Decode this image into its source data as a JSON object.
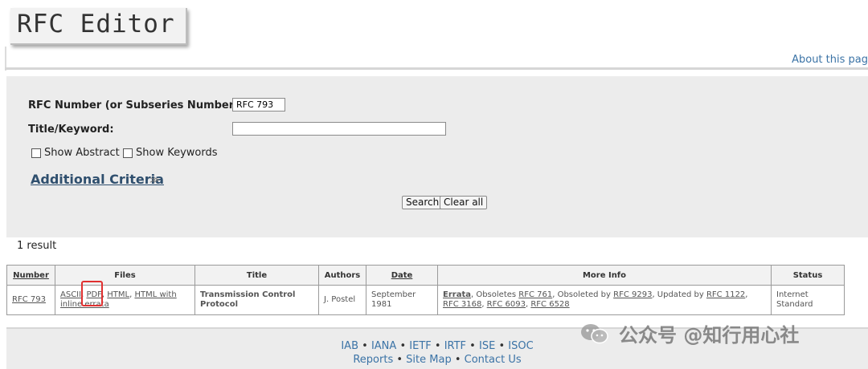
{
  "header": {
    "logo": "RFC Editor",
    "about_link": "About this pag"
  },
  "search": {
    "rfc_number_label": "RFC Number (or Subseries Number):",
    "rfc_number_value": "RFC 793",
    "title_keyword_label": "Title/Keyword:",
    "title_keyword_value": "",
    "show_abstract": "Show Abstract",
    "show_keywords": "Show Keywords",
    "additional_criteria": "Additional Criteria",
    "additional_criteria_icon": "double-chevron-down-icon",
    "search_button": "Search",
    "clear_button": "Clear all"
  },
  "results": {
    "count_text": "1 result",
    "headers": [
      "Number",
      "Files",
      "Title",
      "Authors",
      "Date",
      "More Info",
      "Status"
    ],
    "rows": [
      {
        "number": "RFC 793",
        "files": {
          "ascii": "ASCII",
          "sep1": ", ",
          "pdf": "PDF",
          "sep2": ", ",
          "html": "HTML",
          "sep3": ", ",
          "html_errata_line1": "HTML with",
          "html_errata_line2": "inline errata"
        },
        "title": "Transmission Control Protocol",
        "authors": "J. Postel",
        "date": "September 1981",
        "more_info": {
          "errata": "Errata",
          "obsoletes_prefix": ", Obsoletes ",
          "obsoletes": "RFC 761",
          "obsoleted_prefix": ", Obsoleted by ",
          "obsoleted_by": "RFC 9293",
          "updated_prefix": ", Updated by ",
          "updated_by": [
            "RFC 1122",
            "RFC 3168",
            "RFC 6093",
            "RFC 6528"
          ]
        },
        "status": "Internet Standard"
      }
    ]
  },
  "footer": {
    "row1": [
      "IAB",
      "IANA",
      "IETF",
      "IRTF",
      "ISE",
      "ISOC"
    ],
    "row2": [
      "Reports",
      "Site Map",
      "Contact Us"
    ],
    "separator": "•"
  },
  "watermark": {
    "text": "公众号 @知行用心社",
    "icon": "wechat-icon"
  },
  "colors": {
    "link": "#3b73a6",
    "panel": "#ececec",
    "highlight": "#e03030"
  }
}
